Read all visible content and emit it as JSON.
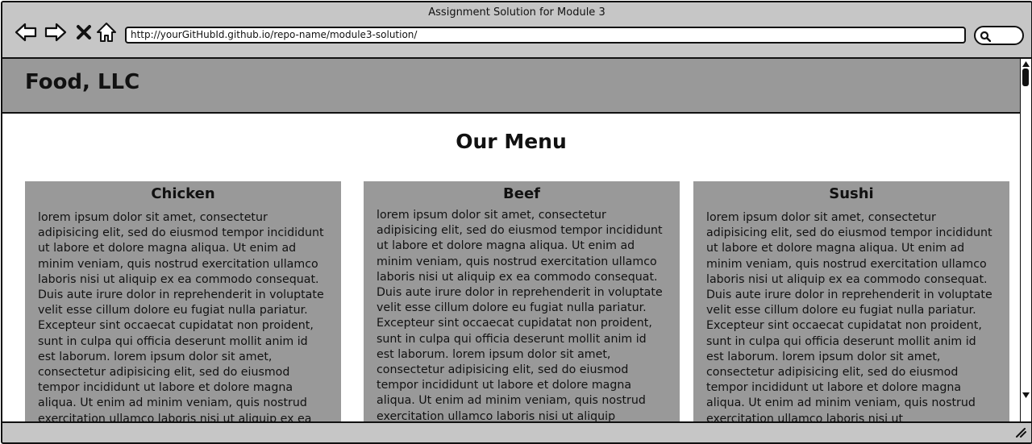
{
  "window": {
    "title": "Assignment Solution for Module 3"
  },
  "toolbar": {
    "back_icon": "arrow-left-icon",
    "forward_icon": "arrow-right-icon",
    "stop_icon": "close-icon",
    "home_icon": "home-icon",
    "url": "http://yourGitHubId.github.io/repo-name/module3-solution/",
    "search_icon": "search-icon"
  },
  "site": {
    "brand": "Food, LLC",
    "heading": "Our Menu",
    "cards": [
      {
        "title": "Chicken",
        "text": "lorem ipsum dolor sit amet, consectetur adipisicing elit, sed do eiusmod tempor incididunt ut labore et dolore magna aliqua. Ut enim ad minim veniam, quis nostrud exercitation ullamco laboris nisi ut aliquip ex ea commodo consequat. Duis aute irure dolor in reprehenderit in voluptate velit esse cillum dolore eu fugiat nulla pariatur. Excepteur sint occaecat cupidatat non proident, sunt in culpa qui officia deserunt mollit anim id est laborum. lorem ipsum dolor sit amet, consectetur adipisicing elit, sed do eiusmod tempor incididunt ut labore et dolore magna aliqua. Ut enim ad minim veniam, quis nostrud exercitation ullamco laboris nisi ut aliquip ex ea"
      },
      {
        "title": "Beef",
        "text": "lorem ipsum dolor sit amet, consectetur adipisicing elit, sed do eiusmod tempor incididunt ut labore et dolore magna aliqua. Ut enim ad minim veniam, quis nostrud exercitation ullamco laboris nisi ut aliquip ex ea commodo consequat. Duis aute irure dolor in reprehenderit in voluptate velit esse cillum dolore eu fugiat nulla pariatur. Excepteur sint occaecat cupidatat non proident, sunt in culpa qui officia deserunt mollit anim id est laborum. lorem ipsum dolor sit amet, consectetur adipisicing elit, sed do eiusmod tempor incididunt ut labore et dolore magna aliqua. Ut enim ad minim veniam, quis nostrud exercitation ullamco laboris nisi ut aliquip"
      },
      {
        "title": "Sushi",
        "text": "lorem ipsum dolor sit amet, consectetur adipisicing elit, sed do eiusmod tempor incididunt ut labore et dolore magna aliqua. Ut enim ad minim veniam, quis nostrud exercitation ullamco laboris nisi ut aliquip ex ea commodo consequat. Duis aute irure dolor in reprehenderit in voluptate velit esse cillum dolore eu fugiat nulla pariatur. Excepteur sint occaecat cupidatat non proident, sunt in culpa qui officia deserunt mollit anim id est laborum. lorem ipsum dolor sit amet, consectetur adipisicing elit, sed do eiusmod tempor incididunt ut labore et dolore magna aliqua. Ut enim ad minim veniam, quis nostrud exercitation ullamco laboris nisi ut"
      }
    ]
  },
  "colors": {
    "chrome": "#c6c6c6",
    "header": "#999999",
    "card": "#999999",
    "ink": "#111111"
  }
}
